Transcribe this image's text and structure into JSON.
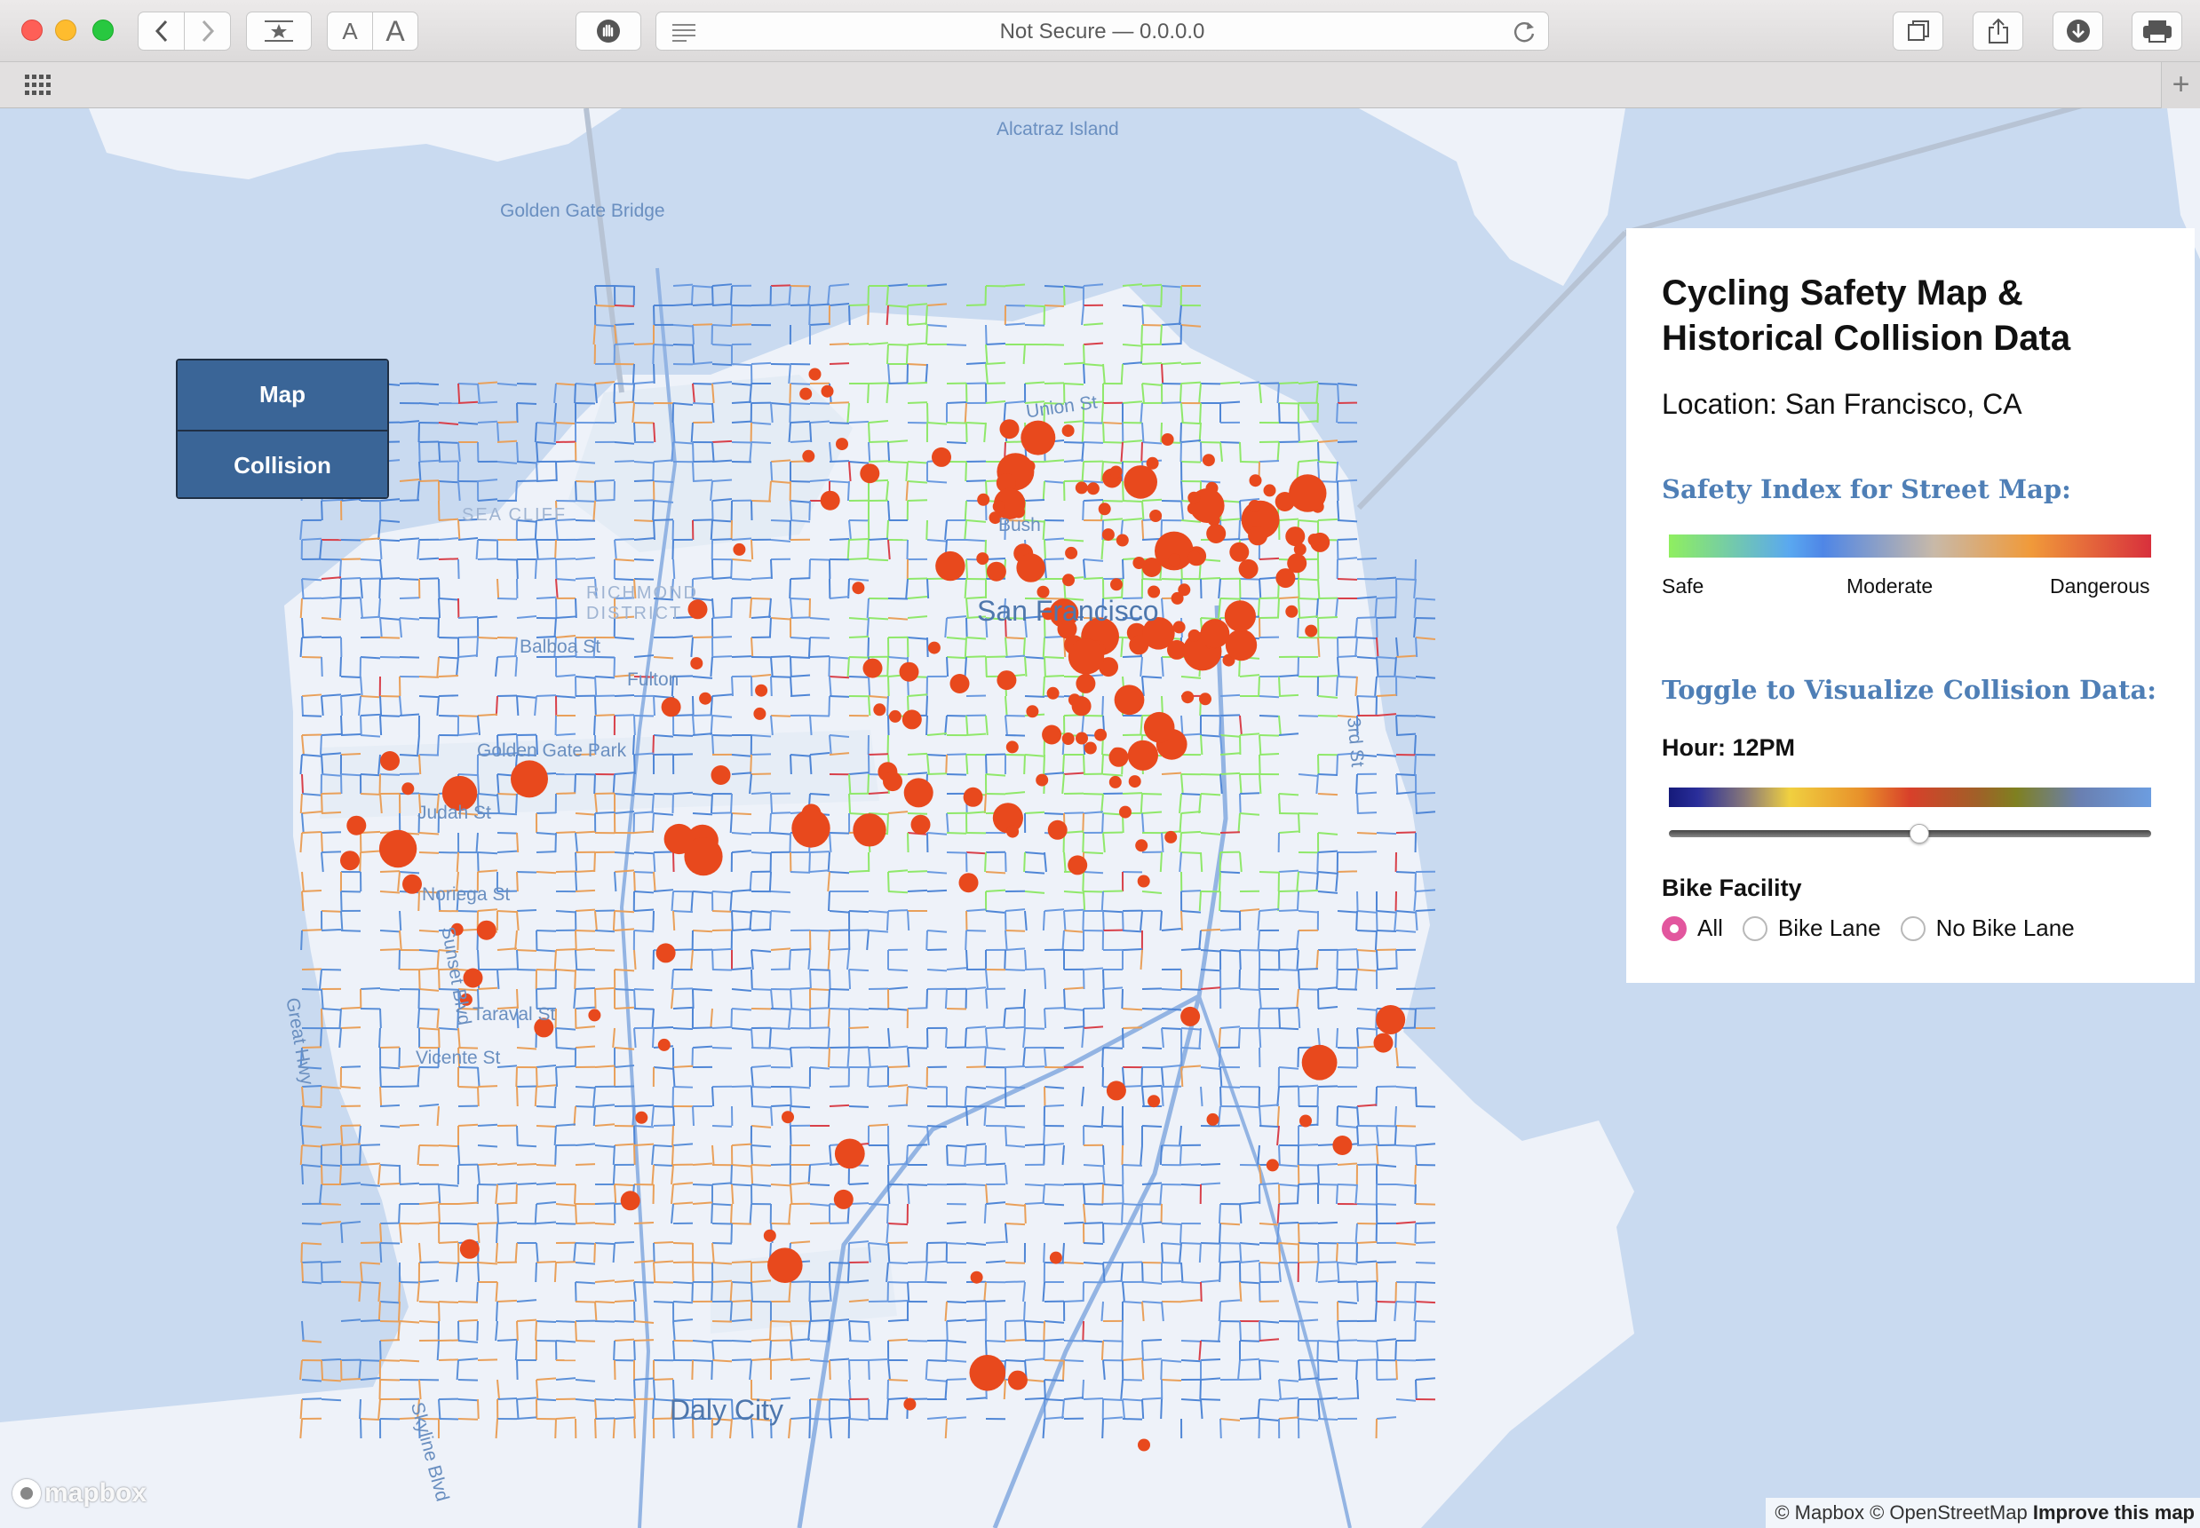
{
  "browser": {
    "address": "Not Secure — 0.0.0.0",
    "font_small": "A",
    "font_large": "A",
    "new_tab": "+",
    "icons": [
      "back-icon",
      "forward-icon",
      "bookmarks-icon",
      "privacy-icon",
      "reader-icon",
      "reload-icon",
      "tabs-icon",
      "share-icon",
      "download-icon",
      "print-icon",
      "apps-grid-icon"
    ]
  },
  "view_toggle": {
    "map_label": "Map",
    "collision_label": "Collision"
  },
  "panel": {
    "title": "Cycling Safety Map & Historical Collision Data",
    "location": "Location: San Francisco, CA",
    "safety_heading": "Safety Index for Street Map:",
    "scale": {
      "safe": "Safe",
      "moderate": "Moderate",
      "dangerous": "Dangerous"
    },
    "safety_colors": [
      "#8fef5f",
      "#4f86e6",
      "#c8b9a8",
      "#f09a3a",
      "#d8303c"
    ],
    "collision_heading": "Toggle to Visualize Collision Data:",
    "hour_label": "Hour: 12PM",
    "hour_slider_fraction": 0.52,
    "facility_label": "Bike Facility",
    "facility_options": [
      "All",
      "Bike Lane",
      "No Bike Lane"
    ],
    "facility_selected": "All"
  },
  "map_labels": {
    "alcatraz": "Alcatraz Island",
    "golden_gate_bridge": "Golden Gate Bridge",
    "san_francisco": "San Francisco",
    "daly_city": "Daly City",
    "balboa": "Balboa St",
    "fulton": "Fulton",
    "golden_gate_park": "Golden Gate Park",
    "judah": "Judah St",
    "noriega": "Noriega St",
    "taraval": "Taraval St",
    "vicente": "Vicente St",
    "union": "Union St",
    "bush": "Bush",
    "great_hwy": "Great Hwy",
    "sunset_blvd": "Sunset Blvd",
    "skyline_blvd": "Skyline Blvd",
    "third_st": "3rd St",
    "richmond": "RICHMOND DISTRICT",
    "sea_cliff": "SEA CLIFF"
  },
  "map_colors": {
    "water": "#c9daf0",
    "land": "#eef2f9",
    "collision_marker": "#e8491d"
  },
  "attribution": {
    "mapbox": "© Mapbox",
    "osm": "© OpenStreetMap",
    "improve": "Improve this map"
  },
  "logo": "mapbox"
}
